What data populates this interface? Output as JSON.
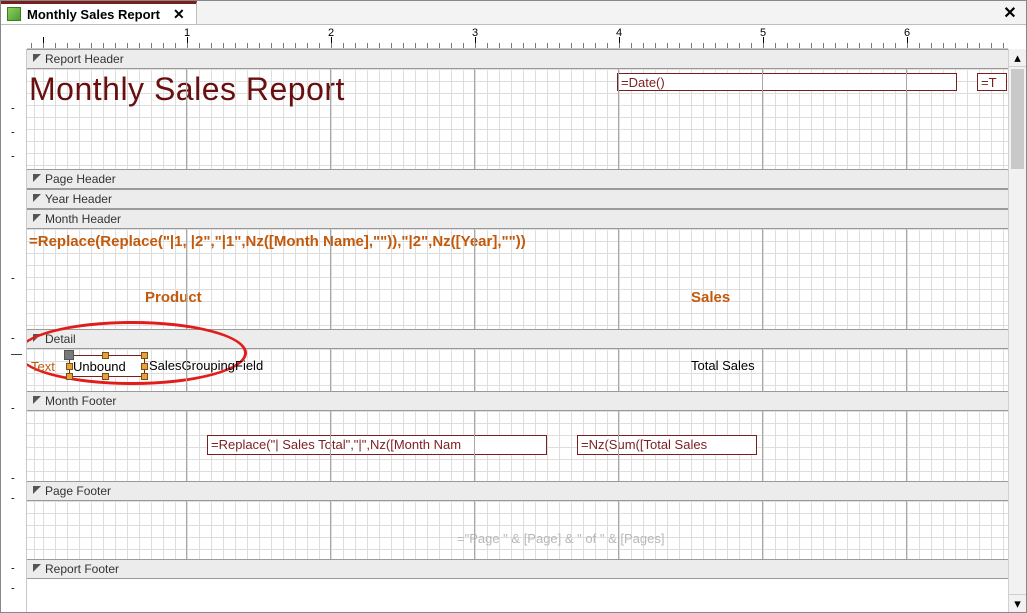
{
  "tab": {
    "title": "Monthly Sales Report"
  },
  "ruler": {
    "numbers": [
      "1",
      "2",
      "3",
      "4",
      "5",
      "6"
    ]
  },
  "sections": {
    "report_header": "Report Header",
    "page_header": "Page Header",
    "year_header": "Year Header",
    "month_header": "Month Header",
    "detail": "Detail",
    "month_footer": "Month Footer",
    "page_footer": "Page Footer",
    "report_footer": "Report Footer"
  },
  "report_header": {
    "title": "Monthly Sales Report",
    "date_expr": "=Date()",
    "time_expr": "=T"
  },
  "month_header": {
    "expr": "=Replace(Replace(\"|1, |2\",\"|1\",Nz([Month Name],\"\")),\"|2\",Nz([Year],\"\"))",
    "col_product": "Product",
    "col_sales": "Sales"
  },
  "detail": {
    "new_label_caption": "Text",
    "new_textbox_value": "Unbound",
    "grouping_field": "SalesGroupingField",
    "total_sales": "Total Sales"
  },
  "month_footer": {
    "left_expr": "=Replace(\"| Sales Total\",\"|\",Nz([Month Nam",
    "right_expr": "=Nz(Sum([Total Sales"
  },
  "page_footer": {
    "expr": "=\"Page \" & [Page] & \" of \" & [Pages]"
  }
}
